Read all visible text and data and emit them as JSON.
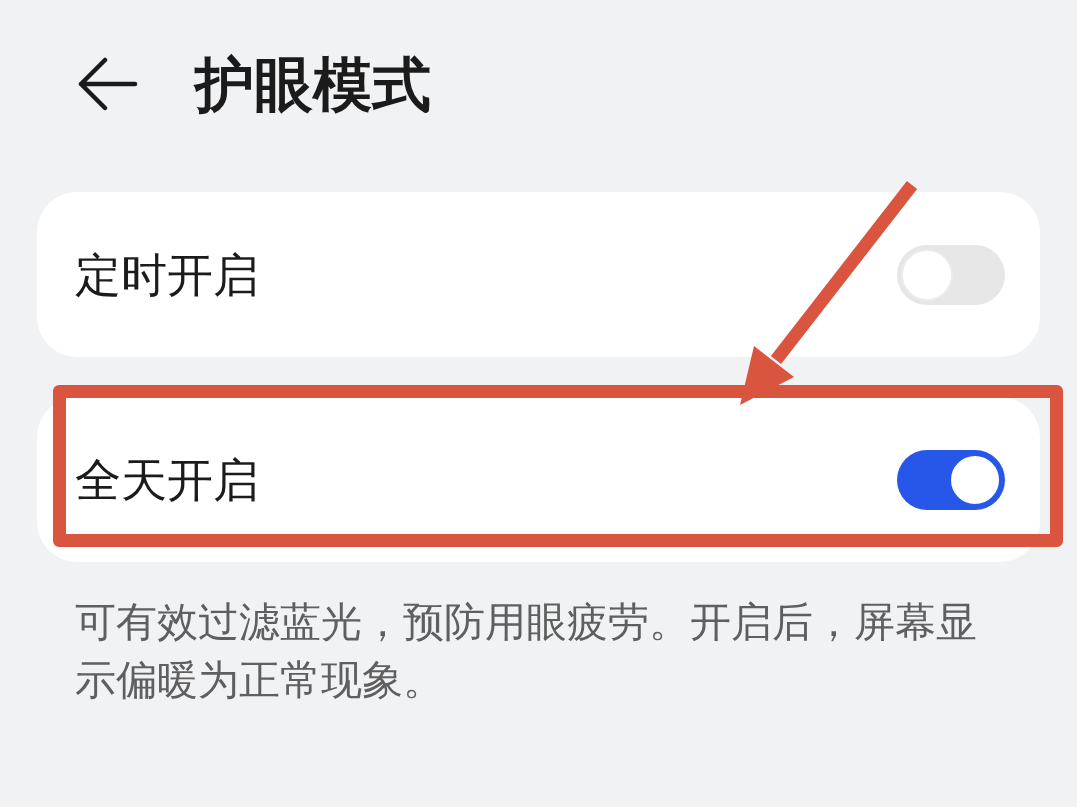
{
  "header": {
    "title": "护眼模式"
  },
  "options": [
    {
      "label": "定时开启",
      "on": false,
      "highlighted": false
    },
    {
      "label": "全天开启",
      "on": true,
      "highlighted": true
    }
  ],
  "description": "可有效过滤蓝光，预防用眼疲劳。开启后，屏幕显示偏暖为正常现象。"
}
